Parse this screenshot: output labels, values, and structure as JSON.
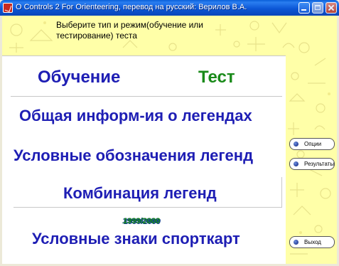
{
  "window": {
    "title": "O Controls 2 For Orienteering, перевод на русский: Верилов В.А."
  },
  "header": {
    "instruction": "Выберите тип и режим(обучение или тестирование) теста"
  },
  "modes": {
    "learning": "Обучение",
    "test": "Тест"
  },
  "menu": {
    "general_info": "Общая информ-ия о легендах",
    "legend_symbols": "Условные обозначения легенд",
    "legend_combination": "Комбинация легенд",
    "map_symbols": "Условные знаки спорткарт"
  },
  "years": "1999/2000",
  "sidebar": {
    "options": "Опции",
    "results": "Результаты",
    "exit": "Выход"
  },
  "colors": {
    "title_bar": "#0c57d6",
    "background": "#ffffa8",
    "menu_text": "#1e1eb4",
    "test_text": "#1a8a1a"
  }
}
